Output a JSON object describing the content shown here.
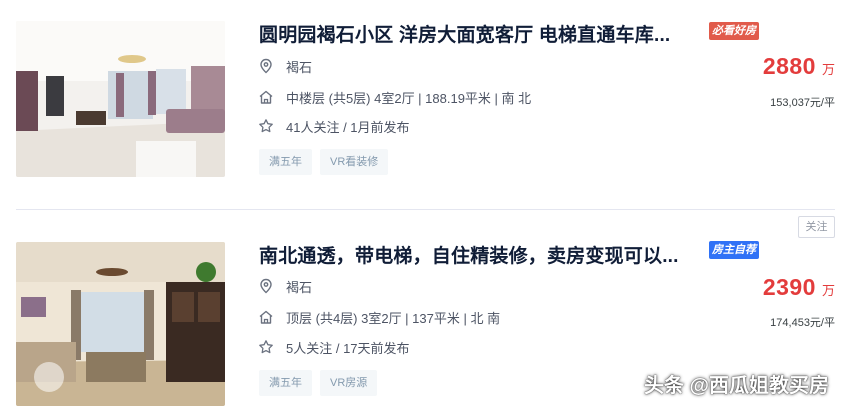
{
  "listings": [
    {
      "title": "圆明园褐石小区 洋房大面宽客厅 电梯直通车库...",
      "badge": "必看好房",
      "location": "褐石",
      "house_info": "中楼层 (共5层) 4室2厅 | 188.19平米 | 南 北",
      "follow_info": "41人关注 / 1月前发布",
      "tags": [
        "满五年",
        "VR看装修"
      ],
      "total_price": "2880",
      "price_unit": "万",
      "unit_price": "153,037元/平",
      "icons": [
        "location-pin-icon",
        "house-icon",
        "star-icon"
      ]
    },
    {
      "title": "南北通透，带电梯，自住精装修，卖房变现可以...",
      "badge": "房主自荐",
      "location": "褐石",
      "house_info": "顶层 (共4层) 3室2厅 | 137平米 | 北 南",
      "follow_info": "5人关注 / 17天前发布",
      "tags": [
        "满五年",
        "VR房源"
      ],
      "total_price": "2390",
      "price_unit": "万",
      "unit_price": "174,453元/平",
      "follow_button": "关注",
      "icons": [
        "location-pin-icon",
        "house-icon",
        "star-icon"
      ]
    }
  ],
  "watermark": "头条 @西瓜姐教买房",
  "colors": {
    "price": "#e33c3c",
    "badge_must_see": "#e15b4b",
    "badge_owner": "#3072f6",
    "tag_bg": "#f4f7f9",
    "tag_text": "#849aae"
  }
}
